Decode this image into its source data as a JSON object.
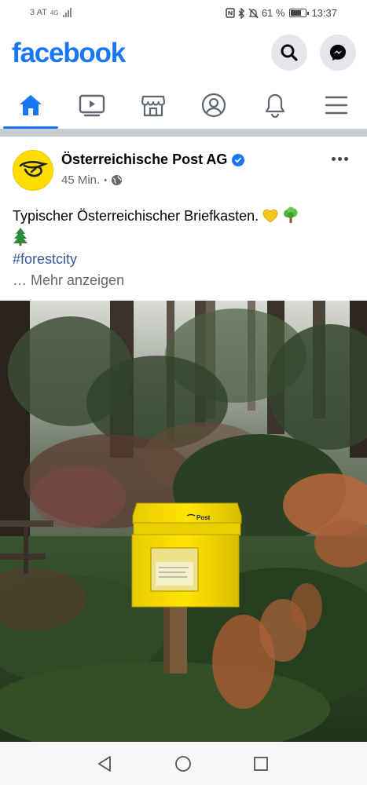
{
  "status_bar": {
    "carrier": "3 AT",
    "network": "4G",
    "battery_text": "61 %",
    "battery_level": 0.61,
    "time": "13:37"
  },
  "header": {
    "logo": "facebook",
    "brand_color": "#1877f2",
    "search_icon": "search-icon",
    "messenger_icon": "messenger-icon"
  },
  "nav": {
    "tabs": [
      {
        "icon": "home-icon",
        "active": true
      },
      {
        "icon": "watch-icon",
        "active": false
      },
      {
        "icon": "marketplace-icon",
        "active": false
      },
      {
        "icon": "profile-icon",
        "active": false
      },
      {
        "icon": "notifications-icon",
        "active": false
      },
      {
        "icon": "menu-icon",
        "active": false
      }
    ]
  },
  "post": {
    "page_name": "Österreichische Post AG",
    "verified": true,
    "time_ago": "45 Min.",
    "separator": "•",
    "privacy_icon": "globe-icon",
    "text": "Typischer Österreichischer Briefkasten.",
    "emojis": [
      "yellow-heart",
      "deciduous-tree",
      "evergreen-tree"
    ],
    "hashtag": "#forestcity",
    "see_more": "… Mehr anzeigen",
    "mailbox_label": "Post"
  },
  "android_nav": {
    "back_icon": "back-icon",
    "home_icon": "home-circle-icon",
    "recents_icon": "recents-icon"
  }
}
